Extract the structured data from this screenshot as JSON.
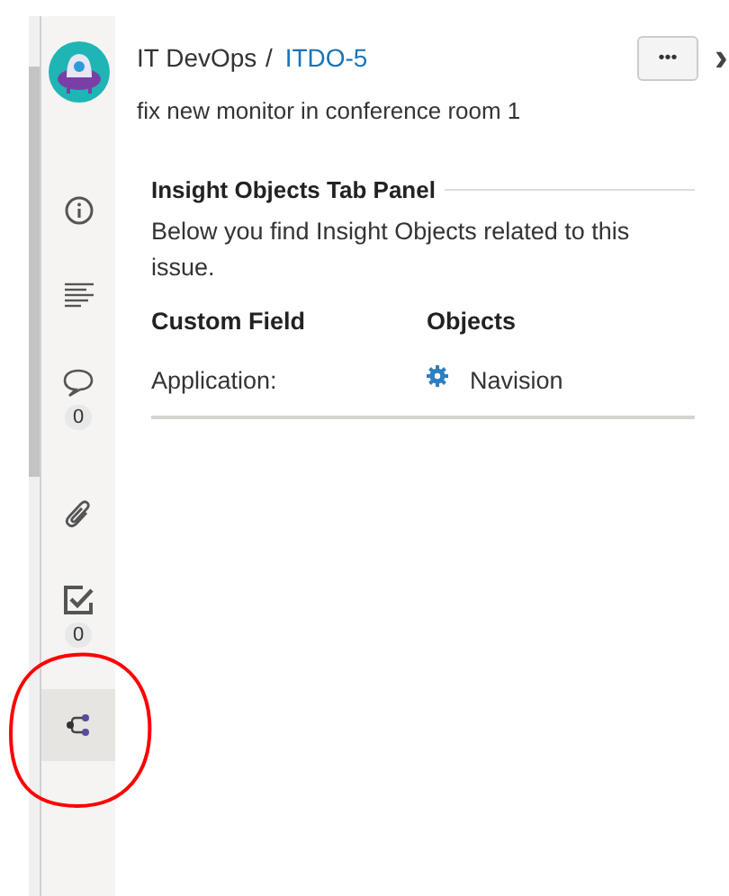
{
  "sidebar": {
    "items": [
      {
        "kind": "info",
        "selected": false
      },
      {
        "kind": "details",
        "selected": false
      },
      {
        "kind": "comments",
        "badge": "0",
        "selected": false
      },
      {
        "kind": "attachments",
        "selected": false
      },
      {
        "kind": "checklist",
        "badge": "0",
        "selected": false
      },
      {
        "kind": "insight",
        "selected": true
      }
    ]
  },
  "breadcrumb": {
    "project": "IT DevOps",
    "separator": "/",
    "issue_key": "ITDO-5"
  },
  "menu_button": "•••",
  "close_button": "›",
  "summary": "fix new monitor in conference room 1",
  "panel": {
    "title": "Insight Objects Tab Panel",
    "description": "Below you find Insight Objects related to this issue.",
    "columns": [
      "Custom Field",
      "Objects"
    ],
    "rows": [
      {
        "field": "Application:",
        "object": "Navision"
      }
    ]
  },
  "annotation": {
    "kind": "ellipse",
    "color": "#ff0000"
  }
}
